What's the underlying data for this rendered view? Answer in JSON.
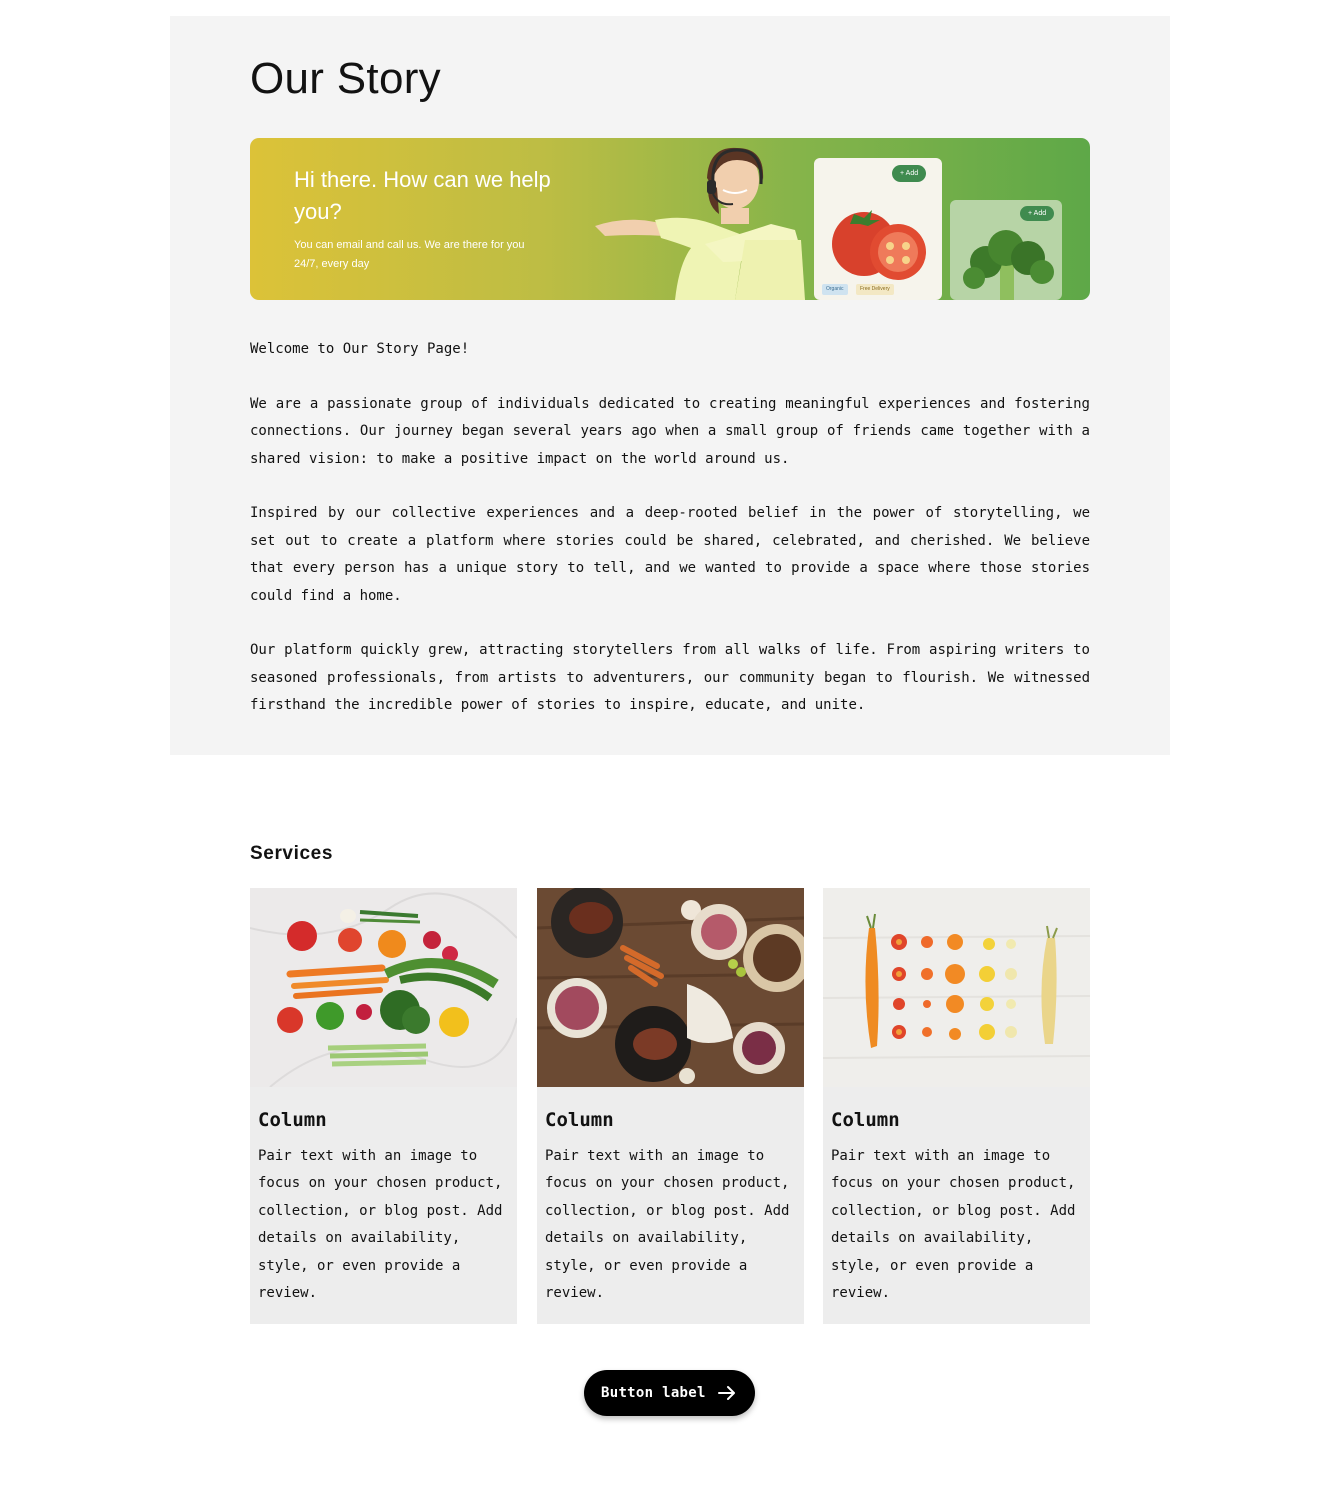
{
  "story": {
    "title": "Our Story",
    "banner": {
      "headline": "Hi there. How can we help you?",
      "subtext": "You can email and call us. We are there for you 24/7, every day",
      "add_label_1": "+ Add",
      "add_label_2": "+ Add",
      "tag_organic": "Organic",
      "tag_delivery": "Free Delivery"
    },
    "paragraphs": [
      "Welcome to Our Story Page!",
      "We are a passionate group of individuals dedicated to creating meaningful experiences and fostering connections. Our journey began several years ago when a small group of friends came together with a shared vision: to make a positive impact on the world around us.",
      "Inspired by our collective experiences and a deep-rooted belief in the power of storytelling, we set out to create a platform where stories could be shared, celebrated, and cherished. We believe that every person has a unique story to tell, and we wanted to provide a space where those stories could find a home.",
      "Our platform quickly grew, attracting storytellers from all walks of life. From aspiring writers to seasoned professionals, from artists to adventurers, our community began to flourish. We witnessed firsthand the incredible power of stories to inspire, educate, and unite."
    ]
  },
  "services": {
    "title": "Services",
    "columns": [
      {
        "image": "vegetables-on-marble-image",
        "heading": "Column",
        "text": "Pair text with an image to focus on your chosen product, collection, or blog post. Add details on availability, style, or even provide a review."
      },
      {
        "image": "grilled-dishes-table-image",
        "heading": "Column",
        "text": "Pair text with an image to focus on your chosen product, collection, or blog post. Add details on availability, style, or even provide a review."
      },
      {
        "image": "sliced-carrots-image",
        "heading": "Column",
        "text": "Pair text with an image to focus on your chosen product, collection, or blog post. Add details on availability, style, or even provide a review."
      }
    ]
  },
  "cta": {
    "label": "Button label",
    "icon": "arrow-right-icon"
  },
  "colors": {
    "story_bg": "#f4f4f4",
    "column_bg": "#ededed",
    "button_bg": "#000000",
    "banner_gradient_start": "#dcc238",
    "banner_gradient_end": "#5ea848"
  }
}
